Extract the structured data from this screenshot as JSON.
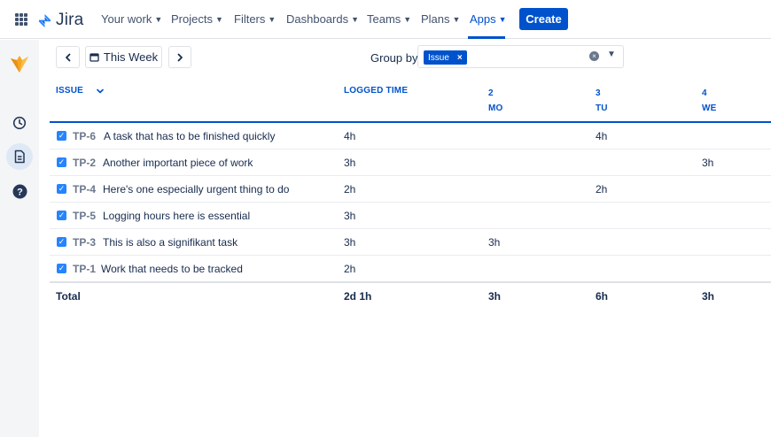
{
  "nav": {
    "logo_text": "Jira",
    "items": [
      {
        "label": "Your work"
      },
      {
        "label": "Projects"
      },
      {
        "label": "Filters"
      },
      {
        "label": "Dashboards"
      },
      {
        "label": "Teams"
      },
      {
        "label": "Plans"
      },
      {
        "label": "Apps"
      }
    ],
    "active_item": "Apps",
    "create_label": "Create"
  },
  "sidebar": {
    "icons": [
      "app-logo-icon",
      "clock-icon",
      "timesheet-icon",
      "help-icon"
    ],
    "active_icon": "timesheet-icon"
  },
  "toolbar": {
    "prev_icon": "chevron-left-icon",
    "period_label": "This Week",
    "next_icon": "chevron-right-icon",
    "groupby_label": "Group by:",
    "groupby_tag": "Issue"
  },
  "table": {
    "col_issue": "ISSUE",
    "col_logged": "LOGGED TIME",
    "days": [
      {
        "num": "2",
        "name": "MO"
      },
      {
        "num": "3",
        "name": "TU"
      },
      {
        "num": "4",
        "name": "WE"
      }
    ],
    "rows": [
      {
        "key": "TP-6",
        "summary": "A task that has to be finished quickly",
        "logged": "4h",
        "mo": "",
        "tu": "4h",
        "we": ""
      },
      {
        "key": "TP-2",
        "summary": "Another important piece of work",
        "logged": "3h",
        "mo": "",
        "tu": "",
        "we": "3h"
      },
      {
        "key": "TP-4",
        "summary": "Here's one especially urgent thing to do",
        "logged": "2h",
        "mo": "",
        "tu": "2h",
        "we": ""
      },
      {
        "key": "TP-5",
        "summary": "Logging hours here is essential",
        "logged": "3h",
        "mo": "",
        "tu": "",
        "we": ""
      },
      {
        "key": "TP-3",
        "summary": "This is also a signifikant task",
        "logged": "3h",
        "mo": "3h",
        "tu": "",
        "we": ""
      },
      {
        "key": "TP-1",
        "summary": "Work that needs to be tracked",
        "logged": "2h",
        "mo": "",
        "tu": "",
        "we": ""
      }
    ],
    "total_label": "Total",
    "total_logged": "2d 1h",
    "total_mo": "3h",
    "total_tu": "6h",
    "total_we": "3h"
  },
  "colors": {
    "accent": "#0052cc",
    "checkbox": "#2684ff",
    "logo_orange": "#f5a623"
  }
}
